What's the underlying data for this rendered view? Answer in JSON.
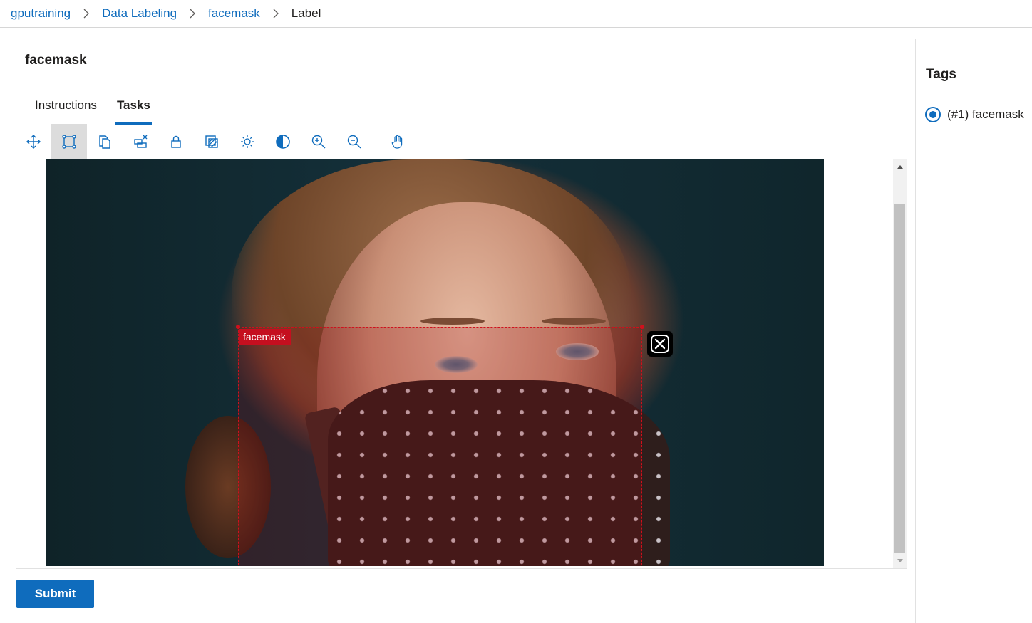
{
  "breadcrumb": {
    "items": [
      "gputraining",
      "Data Labeling",
      "facemask"
    ],
    "current": "Label"
  },
  "page": {
    "title": "facemask"
  },
  "tabs": [
    {
      "label": "Instructions",
      "active": false
    },
    {
      "label": "Tasks",
      "active": true
    }
  ],
  "toolbar": {
    "tools": [
      {
        "name": "move-icon",
        "selected": false
      },
      {
        "name": "rectangle-box-icon",
        "selected": true
      },
      {
        "name": "copy-regions-icon",
        "selected": false
      },
      {
        "name": "delete-all-regions-icon",
        "selected": false
      },
      {
        "name": "lock-icon",
        "selected": false
      },
      {
        "name": "multi-select-icon",
        "selected": false
      },
      {
        "name": "brightness-icon",
        "selected": false
      },
      {
        "name": "contrast-icon",
        "selected": false
      },
      {
        "name": "zoom-in-icon",
        "selected": false
      },
      {
        "name": "zoom-out-icon",
        "selected": false
      },
      {
        "name": "pan-hand-icon",
        "selected": false
      }
    ]
  },
  "annotation": {
    "label": "facemask",
    "color": "#c50f1f"
  },
  "actions": {
    "submit_label": "Submit"
  },
  "tags_panel": {
    "title": "Tags",
    "tags": [
      {
        "label": "(#1) facemask",
        "selected": true
      }
    ]
  },
  "colors": {
    "accent": "#0f6cbd",
    "annotation": "#c50f1f"
  }
}
